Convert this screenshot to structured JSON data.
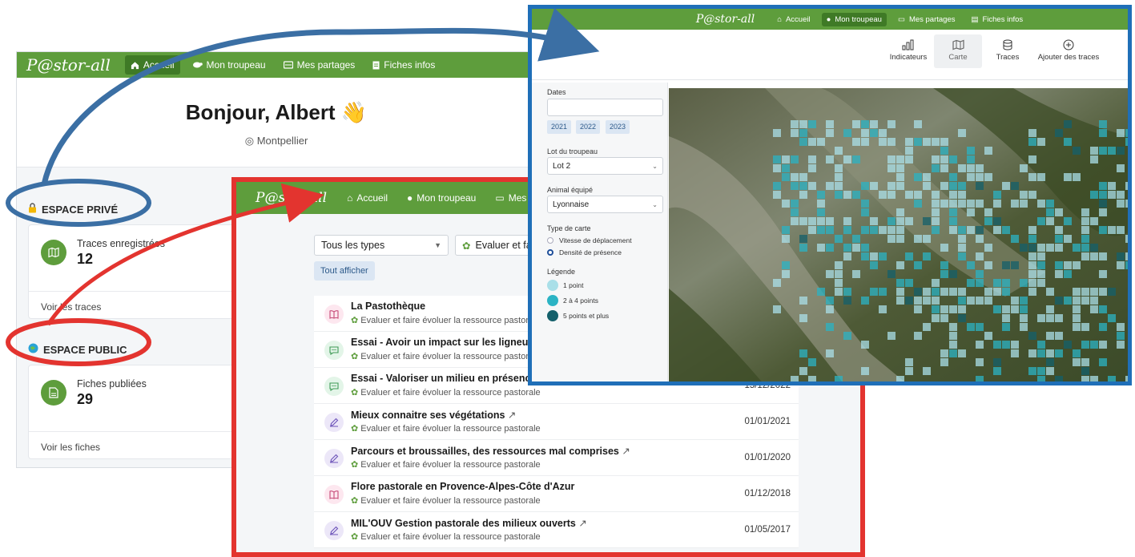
{
  "screen_home": {
    "logo": "P@stor-all",
    "nav": [
      {
        "label": "Accueil",
        "icon": "home-icon"
      },
      {
        "label": "Mon troupeau",
        "icon": "sheep-icon"
      },
      {
        "label": "Mes partages",
        "icon": "share-icon"
      },
      {
        "label": "Fiches infos",
        "icon": "document-icon"
      }
    ],
    "greeting": "Bonjour, Albert 👋",
    "location": "Montpellier",
    "private_space": {
      "title": "ESPACE PRIVÉ",
      "card_label": "Traces enregistrées",
      "card_count": "12",
      "card_link": "Voir les traces"
    },
    "public_space": {
      "title": "ESPACE PUBLIC",
      "card_label": "Fiches publiées",
      "card_count": "29",
      "card_link": "Voir les fiches"
    }
  },
  "screen_fiches": {
    "logo": "P@stor-all",
    "nav": [
      {
        "label": "Accueil"
      },
      {
        "label": "Mon troupeau"
      },
      {
        "label": "Mes partages"
      }
    ],
    "filter_types": "Tous les types",
    "filter_theme": "Evaluer et fai",
    "show_all": "Tout afficher",
    "items": [
      {
        "title": "La Pastothèque",
        "subtitle": "Evaluer et faire évoluer la ressource pastorale",
        "date": "",
        "kind": "book",
        "external": false
      },
      {
        "title": "Essai - Avoir un impact sur les ligneux, dans l",
        "subtitle": "Evaluer et faire évoluer la ressource pastorale",
        "date": "",
        "kind": "chat",
        "external": false
      },
      {
        "title": "Essai - Valoriser un milieu en présence du bra",
        "subtitle": "Evaluer et faire évoluer la ressource pastorale",
        "date": "15/12/2022",
        "kind": "chat",
        "external": false
      },
      {
        "title": "Mieux connaitre ses végétations",
        "subtitle": "Evaluer et faire évoluer la ressource pastorale",
        "date": "01/01/2021",
        "kind": "edit",
        "external": true
      },
      {
        "title": "Parcours et broussailles, des ressources mal comprises",
        "subtitle": "Evaluer et faire évoluer la ressource pastorale",
        "date": "01/01/2020",
        "kind": "edit",
        "external": true
      },
      {
        "title": "Flore pastorale en Provence-Alpes-Côte d'Azur",
        "subtitle": "Evaluer et faire évoluer la ressource pastorale",
        "date": "01/12/2018",
        "kind": "book",
        "external": false
      },
      {
        "title": "MIL'OUV Gestion pastorale des milieux ouverts",
        "subtitle": "Evaluer et faire évoluer la ressource pastorale",
        "date": "01/05/2017",
        "kind": "edit",
        "external": true
      }
    ],
    "colors": {
      "book": "#fde7ef",
      "chat": "#e3f5e8",
      "edit": "#ece7f8"
    }
  },
  "screen_map": {
    "logo": "P@stor-all",
    "nav": [
      {
        "label": "Accueil"
      },
      {
        "label": "Mon troupeau"
      },
      {
        "label": "Mes partages"
      },
      {
        "label": "Fiches infos"
      }
    ],
    "tabs": [
      {
        "label": "Indicateurs",
        "icon": "bar-chart-icon"
      },
      {
        "label": "Carte",
        "icon": "map-icon"
      },
      {
        "label": "Traces",
        "icon": "database-icon"
      },
      {
        "label": "Ajouter des traces",
        "icon": "plus-circle-icon"
      }
    ],
    "dates_label": "Dates",
    "dates_value": "",
    "years": [
      "2021",
      "2022",
      "2023"
    ],
    "lot_label": "Lot du troupeau",
    "lot_value": "Lot 2",
    "animal_label": "Animal équipé",
    "animal_value": "Lyonnaise",
    "map_type_label": "Type de carte",
    "map_types": [
      "Vitesse de déplacement",
      "Densité de présence"
    ],
    "map_type_selected": "Densité de présence",
    "legend_label": "Légende",
    "legend": [
      {
        "label": "1 point",
        "color": "#a9dfe8"
      },
      {
        "label": "2 à 4 points",
        "color": "#2bb3c4"
      },
      {
        "label": "5 points et plus",
        "color": "#14606b"
      }
    ]
  },
  "colors": {
    "brand_green": "#5e9d3c",
    "highlight_red": "#e3342f",
    "highlight_blue": "#1f6fb8",
    "ellipse_blue": "#3b6fa4"
  }
}
